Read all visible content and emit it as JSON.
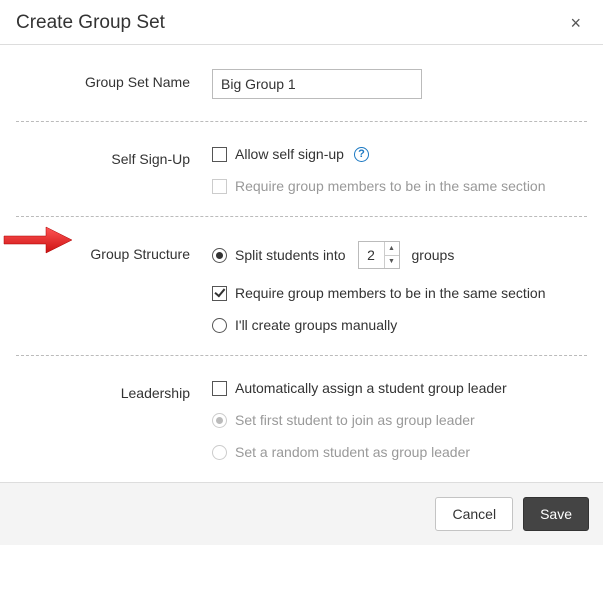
{
  "header": {
    "title": "Create Group Set",
    "close_glyph": "×"
  },
  "group_set_name": {
    "label": "Group Set Name",
    "value": "Big Group 1"
  },
  "self_sign_up": {
    "label": "Self Sign-Up",
    "allow": {
      "label": "Allow self sign-up",
      "checked": false
    },
    "require_same_section": {
      "label": "Require group members to be in the same section",
      "checked": false,
      "disabled": true
    },
    "help_glyph": "?"
  },
  "group_structure": {
    "label": "Group Structure",
    "split": {
      "pre": "Split students into",
      "count": "2",
      "post": "groups",
      "selected": true
    },
    "require_same_section": {
      "label": "Require group members to be in the same section",
      "checked": true
    },
    "manual": {
      "label": "I'll create groups manually",
      "selected": false
    }
  },
  "leadership": {
    "label": "Leadership",
    "auto": {
      "label": "Automatically assign a student group leader",
      "checked": false
    },
    "first": {
      "label": "Set first student to join as group leader",
      "selected": true,
      "disabled": true
    },
    "random": {
      "label": "Set a random student as group leader",
      "selected": false,
      "disabled": true
    }
  },
  "footer": {
    "cancel": "Cancel",
    "save": "Save"
  }
}
